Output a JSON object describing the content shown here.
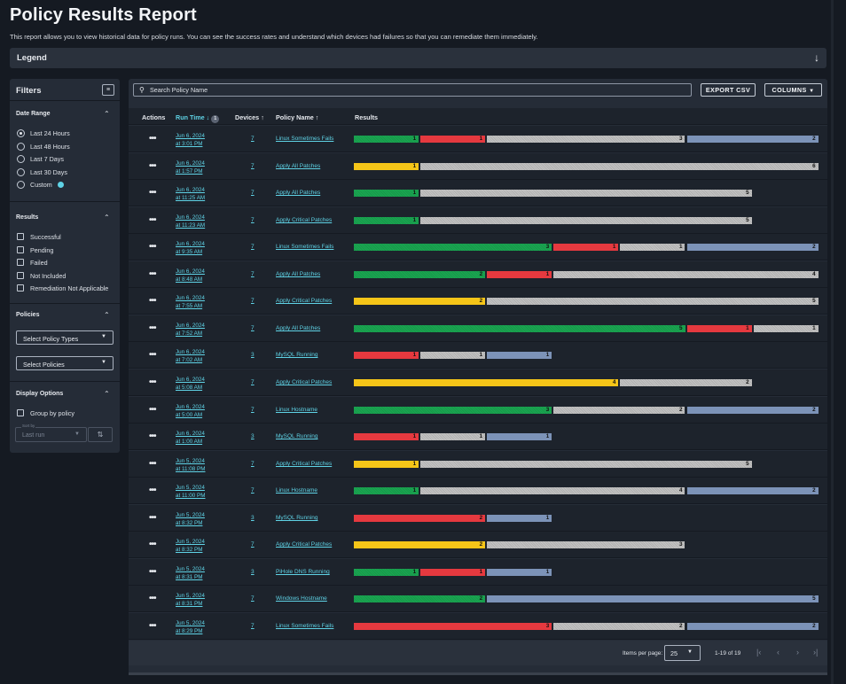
{
  "page": {
    "title": "Policy Results Report",
    "subtitle": "This report allows you to view historical data for policy runs. You can see the success rates and understand which devices had failures so that you can remediate them immediately."
  },
  "legend": {
    "label": "Legend",
    "icon": "arrow-down-icon"
  },
  "filters": {
    "title": "Filters",
    "date_range": {
      "title": "Date Range",
      "options": [
        "Last 24 Hours",
        "Last 48 Hours",
        "Last 7 Days",
        "Last 30 Days",
        "Custom"
      ],
      "selected": "Last 24 Hours"
    },
    "results": {
      "title": "Results",
      "options": [
        "Successful",
        "Pending",
        "Failed",
        "Not Included",
        "Remediation Not Applicable"
      ]
    },
    "policies": {
      "title": "Policies",
      "policy_types_placeholder": "Select Policy Types",
      "policies_placeholder": "Select Policies"
    },
    "display_options": {
      "title": "Display Options",
      "group_by": "Group by policy",
      "sort_label": "Sort by",
      "sort_value": "Last run"
    }
  },
  "toolbar": {
    "search_placeholder": "Search Policy Name",
    "export_label": "EXPORT CSV",
    "columns_label": "COLUMNS"
  },
  "table": {
    "headers": {
      "actions": "Actions",
      "run_time": "Run Time",
      "run_time_sort_badge": "1",
      "devices": "Devices",
      "policy_name": "Policy Name",
      "results": "Results"
    },
    "colors": {
      "successful": "#1aa653",
      "pending": "#f5c518",
      "failed": "#e5393f",
      "not_included": "#bfbfbf",
      "remediation_not_applicable": "#7c93b8"
    },
    "rows": [
      {
        "date": "Jun 6, 2024",
        "time": "at 3:01 PM",
        "devices": "7",
        "policy": "Linux Sometimes Fails",
        "segments": [
          [
            "successful",
            1
          ],
          [
            "failed",
            1
          ],
          [
            "not_included",
            3
          ],
          [
            "remediation_not_applicable",
            2
          ]
        ]
      },
      {
        "date": "Jun 6, 2024",
        "time": "at 1:57 PM",
        "devices": "7",
        "policy": "Apply All Patches",
        "segments": [
          [
            "pending",
            1
          ],
          [
            "not_included",
            6
          ]
        ]
      },
      {
        "date": "Jun 6, 2024",
        "time": "at 11:25 AM",
        "devices": "7",
        "policy": "Apply All Patches",
        "segments": [
          [
            "successful",
            1
          ],
          [
            "not_included",
            5
          ]
        ]
      },
      {
        "date": "Jun 6, 2024",
        "time": "at 11:23 AM",
        "devices": "7",
        "policy": "Apply Critical Patches",
        "segments": [
          [
            "successful",
            1
          ],
          [
            "not_included",
            5
          ]
        ]
      },
      {
        "date": "Jun 6, 2024",
        "time": "at 9:35 AM",
        "devices": "7",
        "policy": "Linux Sometimes Fails",
        "segments": [
          [
            "successful",
            3
          ],
          [
            "failed",
            1
          ],
          [
            "not_included",
            1
          ],
          [
            "remediation_not_applicable",
            2
          ]
        ]
      },
      {
        "date": "Jun 6, 2024",
        "time": "at 8:48 AM",
        "devices": "7",
        "policy": "Apply All Patches",
        "segments": [
          [
            "successful",
            2
          ],
          [
            "failed",
            1
          ],
          [
            "not_included",
            4
          ]
        ]
      },
      {
        "date": "Jun 6, 2024",
        "time": "at 7:55 AM",
        "devices": "7",
        "policy": "Apply Critical Patches",
        "segments": [
          [
            "pending",
            2
          ],
          [
            "not_included",
            5
          ]
        ]
      },
      {
        "date": "Jun 6, 2024",
        "time": "at 7:52 AM",
        "devices": "7",
        "policy": "Apply All Patches",
        "segments": [
          [
            "successful",
            5
          ],
          [
            "failed",
            1
          ],
          [
            "not_included",
            1
          ]
        ]
      },
      {
        "date": "Jun 6, 2024",
        "time": "at 7:02 AM",
        "devices": "3",
        "policy": "MySQL Running",
        "segments": [
          [
            "failed",
            1
          ],
          [
            "not_included",
            1
          ],
          [
            "remediation_not_applicable",
            1
          ]
        ]
      },
      {
        "date": "Jun 6, 2024",
        "time": "at 5:08 AM",
        "devices": "7",
        "policy": "Apply Critical Patches",
        "segments": [
          [
            "pending",
            4
          ],
          [
            "not_included",
            2
          ]
        ]
      },
      {
        "date": "Jun 6, 2024",
        "time": "at 5:00 AM",
        "devices": "7",
        "policy": "Linux Hostname",
        "segments": [
          [
            "successful",
            3
          ],
          [
            "not_included",
            2
          ],
          [
            "remediation_not_applicable",
            2
          ]
        ]
      },
      {
        "date": "Jun 6, 2024",
        "time": "at 1:00 AM",
        "devices": "3",
        "policy": "MySQL Running",
        "segments": [
          [
            "failed",
            1
          ],
          [
            "not_included",
            1
          ],
          [
            "remediation_not_applicable",
            1
          ]
        ]
      },
      {
        "date": "Jun 5, 2024",
        "time": "at 11:08 PM",
        "devices": "7",
        "policy": "Apply Critical Patches",
        "segments": [
          [
            "pending",
            1
          ],
          [
            "not_included",
            5
          ]
        ]
      },
      {
        "date": "Jun 5, 2024",
        "time": "at 11:00 PM",
        "devices": "7",
        "policy": "Linux Hostname",
        "segments": [
          [
            "successful",
            1
          ],
          [
            "not_included",
            4
          ],
          [
            "remediation_not_applicable",
            2
          ]
        ]
      },
      {
        "date": "Jun 5, 2024",
        "time": "at 8:32 PM",
        "devices": "3",
        "policy": "MySQL Running",
        "segments": [
          [
            "failed",
            2
          ],
          [
            "remediation_not_applicable",
            1
          ]
        ]
      },
      {
        "date": "Jun 5, 2024",
        "time": "at 8:32 PM",
        "devices": "7",
        "policy": "Apply Critical Patches",
        "segments": [
          [
            "pending",
            2
          ],
          [
            "not_included",
            3
          ]
        ]
      },
      {
        "date": "Jun 5, 2024",
        "time": "at 8:31 PM",
        "devices": "3",
        "policy": "PiHole DNS Running",
        "segments": [
          [
            "successful",
            1
          ],
          [
            "failed",
            1
          ],
          [
            "remediation_not_applicable",
            1
          ]
        ]
      },
      {
        "date": "Jun 5, 2024",
        "time": "at 8:31 PM",
        "devices": "7",
        "policy": "Windows Hostname",
        "segments": [
          [
            "successful",
            2
          ],
          [
            "remediation_not_applicable",
            5
          ]
        ]
      },
      {
        "date": "Jun 5, 2024",
        "time": "at 8:29 PM",
        "devices": "7",
        "policy": "Linux Sometimes Fails",
        "segments": [
          [
            "failed",
            3
          ],
          [
            "not_included",
            2
          ],
          [
            "remediation_not_applicable",
            2
          ]
        ]
      }
    ]
  },
  "pagination": {
    "items_per_page_label": "Items per page:",
    "items_per_page": "25",
    "range": "1-19 of 19"
  }
}
